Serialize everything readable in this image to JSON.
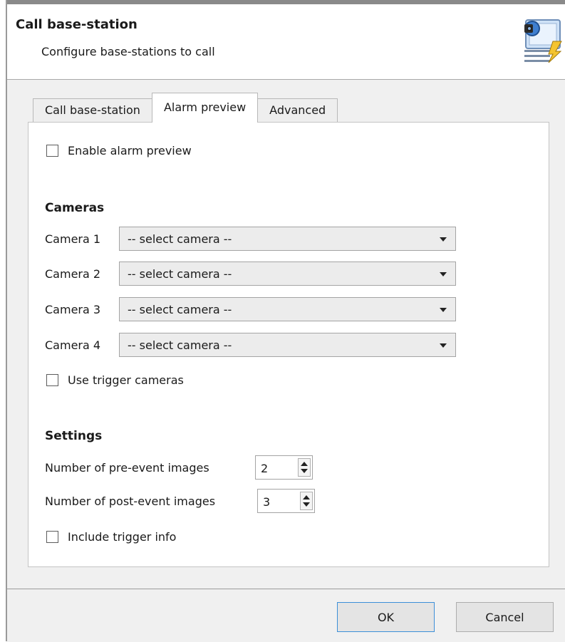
{
  "header": {
    "title": "Call base-station",
    "subtitle": "Configure base-stations to call",
    "icon": "base-station-call-icon"
  },
  "tabs": [
    {
      "label": "Call base-station",
      "active": false
    },
    {
      "label": "Alarm preview",
      "active": true
    },
    {
      "label": "Advanced",
      "active": false
    }
  ],
  "alarm_preview": {
    "enable_label": "Enable alarm preview",
    "enable_checked": false,
    "cameras_heading": "Cameras",
    "cameras": [
      {
        "label": "Camera 1",
        "value": "-- select camera --"
      },
      {
        "label": "Camera 2",
        "value": "-- select camera --"
      },
      {
        "label": "Camera 3",
        "value": "-- select camera --"
      },
      {
        "label": "Camera 4",
        "value": "-- select camera --"
      }
    ],
    "use_trigger_label": "Use trigger cameras",
    "use_trigger_checked": false,
    "settings_heading": "Settings",
    "pre_event_label": "Number of pre-event images",
    "pre_event_value": "2",
    "post_event_label": "Number of post-event images",
    "post_event_value": "3",
    "include_trigger_label": "Include trigger info",
    "include_trigger_checked": false
  },
  "footer": {
    "ok_label": "OK",
    "cancel_label": "Cancel"
  },
  "colors": {
    "default_button_border": "#3c8fd8",
    "dialog_background": "#f0f0f0"
  }
}
